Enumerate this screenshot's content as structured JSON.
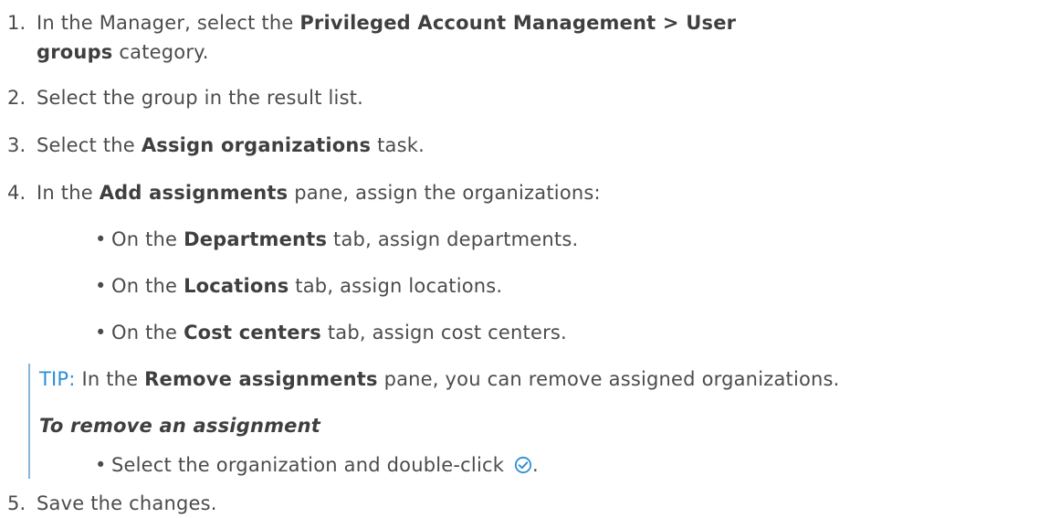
{
  "steps": {
    "s1": {
      "num": "1.",
      "pre": "In the Manager, select the ",
      "bold": "Privileged Account Management > User",
      "bold2": "groups",
      "post": " category."
    },
    "s2": {
      "num": "2.",
      "text": "Select the group in the result list."
    },
    "s3": {
      "num": "3.",
      "pre": "Select the ",
      "bold": "Assign organizations",
      "post": " task."
    },
    "s4": {
      "num": "4.",
      "pre": "In the ",
      "bold": "Add assignments",
      "post": " pane, assign the organizations:"
    },
    "s5": {
      "num": "5.",
      "text": "Save the changes."
    }
  },
  "bullets": [
    {
      "pre": "On the ",
      "bold": "Departments",
      "post": " tab, assign departments."
    },
    {
      "pre": "On the ",
      "bold": "Locations",
      "post": " tab, assign locations."
    },
    {
      "pre": "On the ",
      "bold": "Cost centers",
      "post": " tab, assign cost centers."
    }
  ],
  "tip": {
    "label": "TIP:",
    "pre": " In the ",
    "bold": "Remove assignments",
    "post": " pane, you can remove assigned organizations.",
    "heading": "To remove an assignment",
    "bullet_text": "Select the organization and double-click ",
    "bullet_end": ".",
    "icon": "check-circle-icon",
    "icon_color": "#2e8fd6"
  },
  "bullet_char": "•"
}
